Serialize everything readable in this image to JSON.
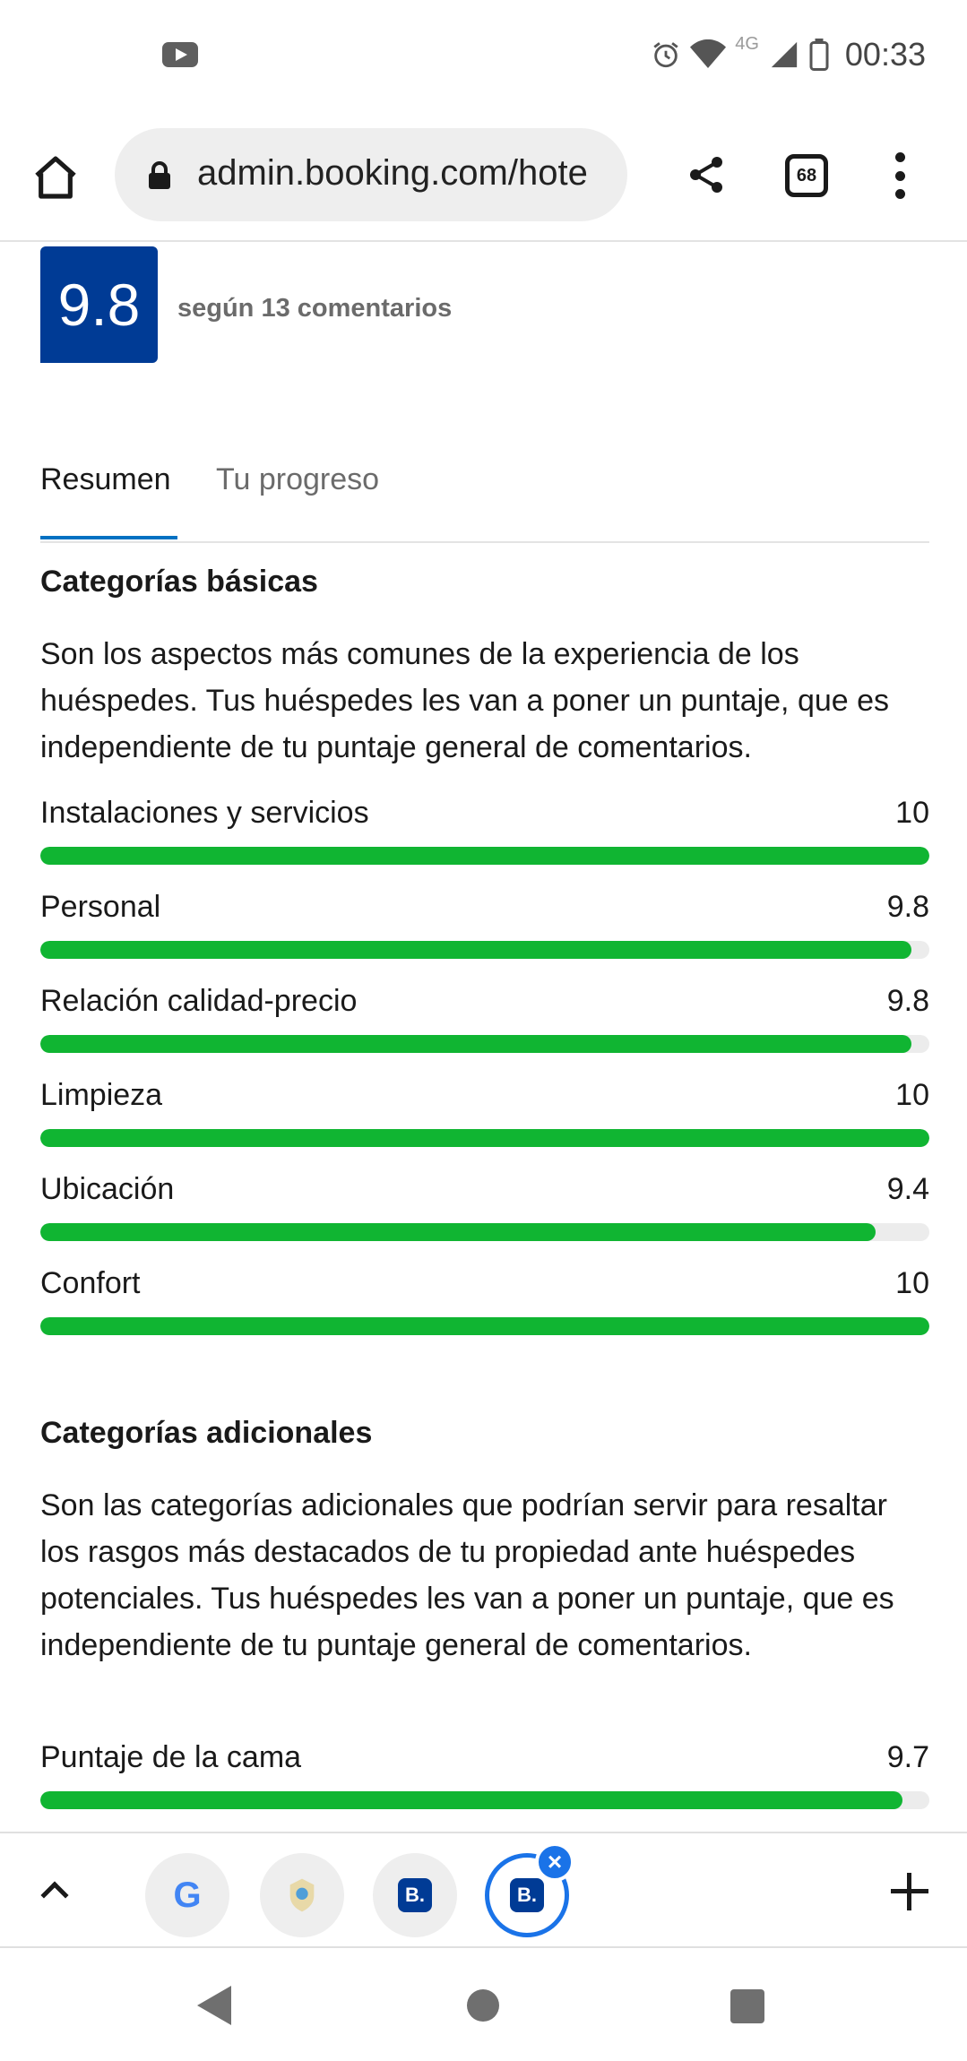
{
  "status_bar": {
    "network": "4G",
    "time": "00:33",
    "icons": [
      "youtube-icon",
      "alarm-icon",
      "wifi-icon",
      "signal-icon",
      "battery-icon"
    ]
  },
  "browser": {
    "url": "admin.booking.com/hote",
    "tab_count": "68",
    "icons": [
      "home-icon",
      "lock-icon",
      "share-icon",
      "tabs-icon",
      "more-icon"
    ]
  },
  "score": {
    "value": "9.8",
    "subtitle": "según 13 comentarios",
    "color": "#003b95"
  },
  "tabs": [
    {
      "label": "Resumen",
      "active": true
    },
    {
      "label": "Tu progreso",
      "active": false
    }
  ],
  "basic": {
    "title": "Categorías básicas",
    "description": "Son los aspectos más comunes de la experiencia de los huéspedes. Tus huéspedes les van a poner un puntaje, que es independiente de tu puntaje general de comentarios.",
    "ratings": [
      {
        "label": "Instalaciones y servicios",
        "value": "10",
        "score": 10
      },
      {
        "label": "Personal",
        "value": "9.8",
        "score": 9.8
      },
      {
        "label": "Relación calidad-precio",
        "value": "9.8",
        "score": 9.8
      },
      {
        "label": "Limpieza",
        "value": "10",
        "score": 10
      },
      {
        "label": "Ubicación",
        "value": "9.4",
        "score": 9.4
      },
      {
        "label": "Confort",
        "value": "10",
        "score": 10
      }
    ]
  },
  "additional": {
    "title": "Categorías adicionales",
    "description": "Son las categorías adicionales que podrían servir para resaltar los rasgos más destacados de tu propiedad ante huéspedes potenciales. Tus huéspedes les van a poner un puntaje, que es independiente de tu puntaje general de comentarios.",
    "ratings": [
      {
        "label": "Puntaje de la cama",
        "value": "9.7",
        "score": 9.7
      }
    ]
  },
  "rating_max": 10,
  "bar_color": "#10b532",
  "tab_strip": {
    "tabs": [
      {
        "icon": "google-favicon",
        "letter": "G"
      },
      {
        "icon": "site-favicon",
        "letter": ""
      },
      {
        "icon": "booking-favicon",
        "letter": "B."
      },
      {
        "icon": "booking-favicon",
        "letter": "B.",
        "selected": true
      }
    ]
  }
}
